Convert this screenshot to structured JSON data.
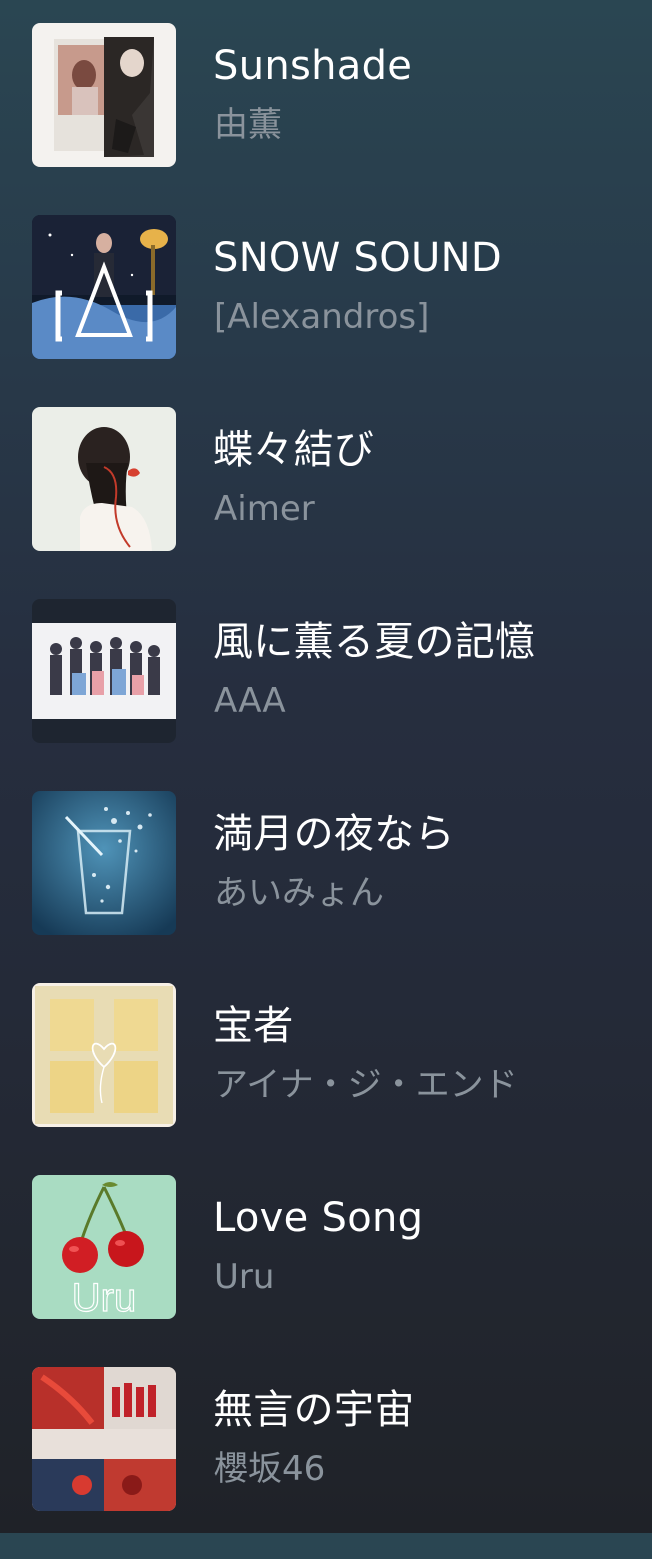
{
  "songs": [
    {
      "title": "Sunshade",
      "artist": "由薫",
      "art": "sunshade-cover-art"
    },
    {
      "title": "SNOW SOUND",
      "artist": "[Alexandros]",
      "art": "snow-sound-cover-art"
    },
    {
      "title": "蝶々結び",
      "artist": "Aimer",
      "art": "chouchou-musubi-cover-art"
    },
    {
      "title": "風に薫る夏の記憶",
      "artist": "AAA",
      "art": "kaze-ni-kaoru-cover-art"
    },
    {
      "title": "満月の夜なら",
      "artist": "あいみょん",
      "art": "mangetsu-cover-art"
    },
    {
      "title": "宝者",
      "artist": "アイナ・ジ・エンド",
      "art": "takaramono-cover-art"
    },
    {
      "title": "Love Song",
      "artist": "Uru",
      "art": "love-song-cover-art",
      "art_text": "Uru"
    },
    {
      "title": "無言の宇宙",
      "artist": "櫻坂46",
      "art": "mugon-no-uchuu-cover-art"
    }
  ]
}
